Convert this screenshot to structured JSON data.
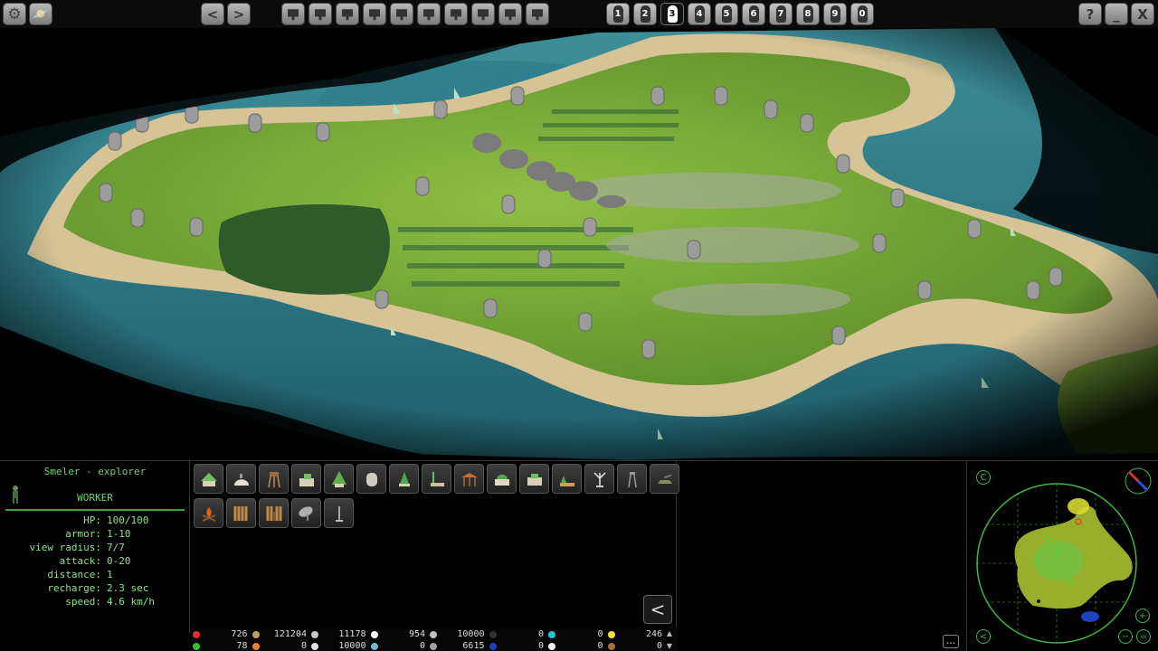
{
  "topbar": {
    "settings_icon": "gear-icon",
    "diplomacy_icon": "planet-icon",
    "nav_back": "<",
    "nav_forward": ">",
    "camera_slots": 10,
    "players": [
      "1",
      "2",
      "3",
      "4",
      "5",
      "6",
      "7",
      "8",
      "9",
      "0"
    ],
    "selected_player_index": 2,
    "help_label": "?",
    "minimize_label": "_",
    "close_label": "X"
  },
  "unit": {
    "name": "Smeler - explorer",
    "role": "WORKER",
    "stats": [
      {
        "label": "HP:",
        "value": "100/100"
      },
      {
        "label": "armor:",
        "value": "1-10"
      },
      {
        "label": "view radius:",
        "value": "7/7"
      },
      {
        "label": "attack:",
        "value": "0-20"
      },
      {
        "label": "distance:",
        "value": "1"
      },
      {
        "label": "recharge:",
        "value": "2.3 sec"
      },
      {
        "label": "speed:",
        "value": "4.6 km/h"
      }
    ]
  },
  "build_menu": {
    "row1": [
      "hut-icon",
      "dome-icon",
      "watchtower-icon",
      "barracks-icon",
      "tree-house-icon",
      "stone-tower-icon",
      "shrine-icon",
      "workshop-icon",
      "pavilion-icon",
      "temple-icon",
      "market-icon",
      "farm-icon",
      "antenna-icon",
      "lookout-icon",
      "cannon-icon"
    ],
    "row2": [
      "campfire-icon",
      "wood-fence-icon",
      "gate-icon",
      "radar-dish-icon",
      "lamp-post-icon"
    ],
    "collapse_label": "<"
  },
  "resources": {
    "row1": [
      {
        "color": "#e03030",
        "value": "726"
      },
      {
        "color": "#b8a060",
        "value": "121204"
      },
      {
        "color": "#c8c8c8",
        "value": "11178"
      },
      {
        "color": "#ffffff",
        "value": "954"
      },
      {
        "color": "#c0c0c0",
        "value": "10000"
      },
      {
        "color": "#303030",
        "value": "0"
      },
      {
        "color": "#20c8d8",
        "value": "0"
      },
      {
        "color": "#f0e040",
        "value": "246"
      }
    ],
    "row2": [
      {
        "color": "#30c030",
        "value": "78"
      },
      {
        "color": "#f08020",
        "value": "0"
      },
      {
        "color": "#e0e0e0",
        "value": "10000"
      },
      {
        "color": "#70b8d0",
        "value": "0"
      },
      {
        "color": "#a0a0a0",
        "value": "6615"
      },
      {
        "color": "#2040c0",
        "value": "0"
      },
      {
        "color": "#f0f0f0",
        "value": "0"
      },
      {
        "color": "#a87040",
        "value": "0"
      }
    ]
  },
  "minimap": {
    "center_label": "C",
    "zoom_in_label": "+",
    "zoom_out_label": "−",
    "zoom_reset_label": "=",
    "back_label": "<",
    "compass_icon": "compass-icon",
    "chat_icon": "chat-icon"
  },
  "colors": {
    "accent": "#3fb83f",
    "text": "#8fe08f",
    "water": "#2f7f8c",
    "grass": "#7aa83a",
    "sand": "#d6c497"
  }
}
